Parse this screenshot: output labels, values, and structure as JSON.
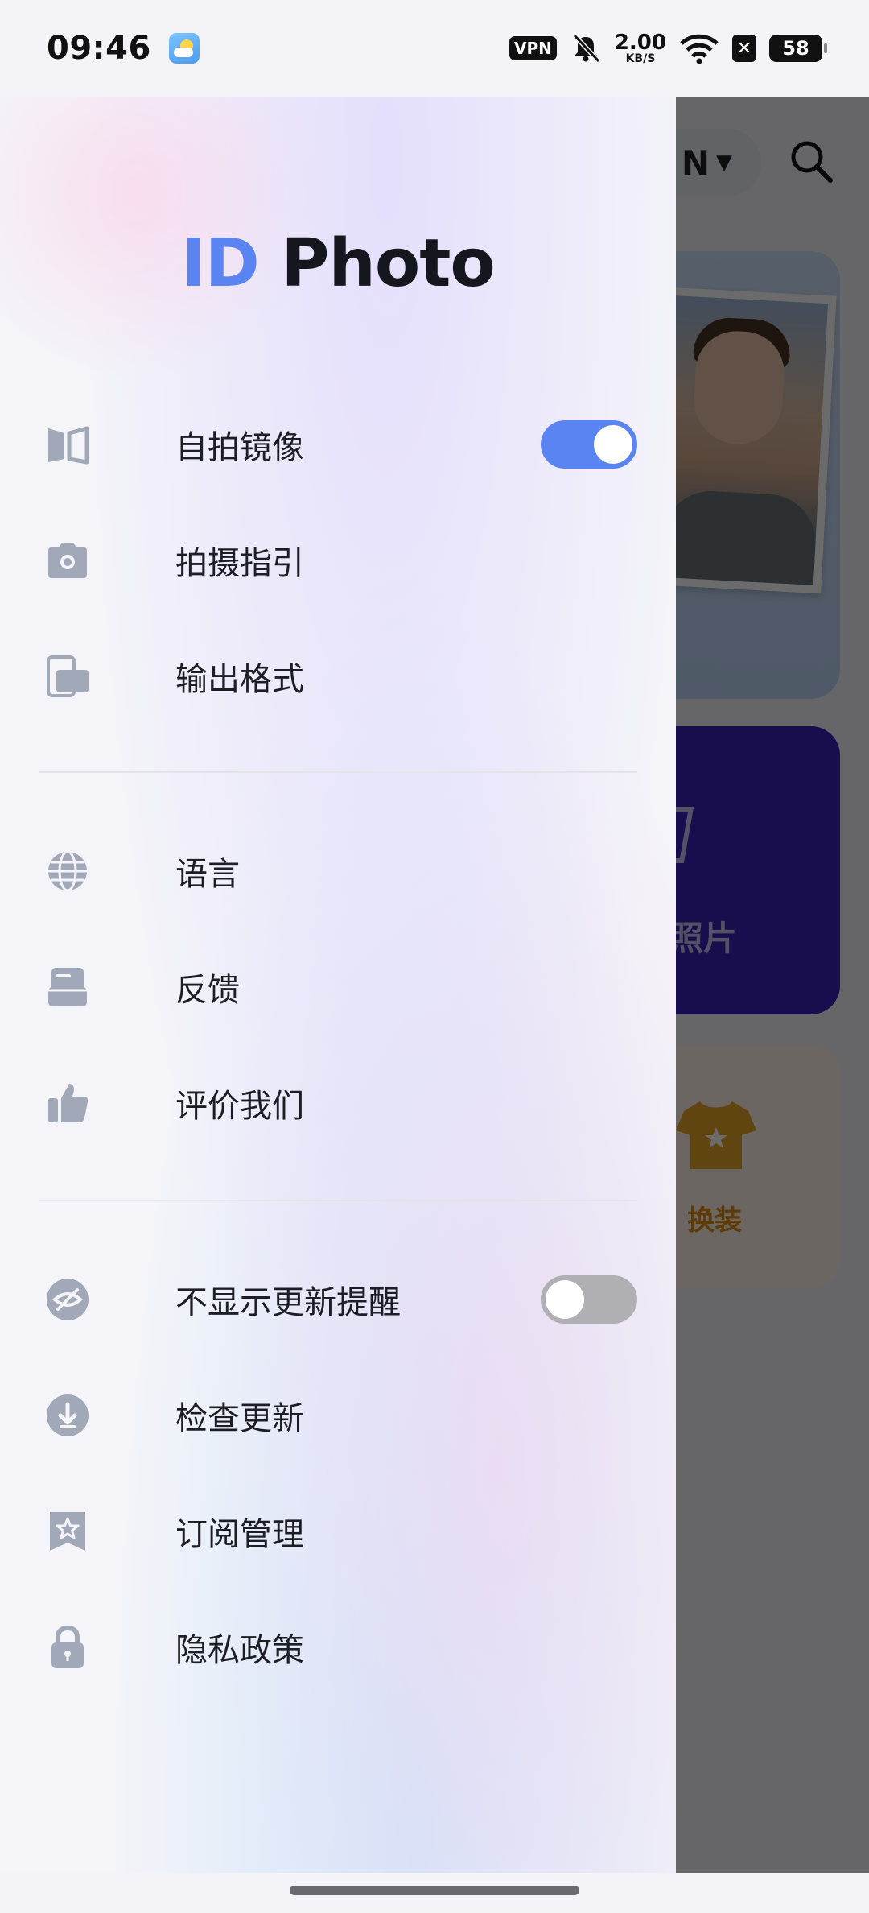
{
  "status_bar": {
    "time": "09:46",
    "weather_icon": "partly-cloudy-icon",
    "vpn": "VPN",
    "net_speed_value": "2.00",
    "net_speed_unit": "KB/S",
    "battery": "58",
    "icons": [
      "mute-bell-icon",
      "wifi-icon",
      "x-app-icon",
      "battery-icon"
    ]
  },
  "background_app": {
    "language_pill": "N",
    "card_purple_label": "照片",
    "card_orange_label": "换装"
  },
  "drawer": {
    "title_part1": "ID",
    "title_part2": "Photo",
    "accent_color": "#5b84f3",
    "icon_color": "#a1a8b8",
    "groups": [
      {
        "items": [
          {
            "label": "自拍镜像",
            "icon": "mirror-icon",
            "toggle": true
          },
          {
            "label": "拍摄指引",
            "icon": "camera-icon"
          },
          {
            "label": "输出格式",
            "icon": "format-icon"
          }
        ]
      },
      {
        "items": [
          {
            "label": "语言",
            "icon": "globe-icon"
          },
          {
            "label": "反馈",
            "icon": "feedback-icon"
          },
          {
            "label": "评价我们",
            "icon": "thumbs-up-icon"
          }
        ]
      },
      {
        "items": [
          {
            "label": "不显示更新提醒",
            "icon": "eye-off-icon",
            "toggle": false
          },
          {
            "label": "检查更新",
            "icon": "download-icon"
          },
          {
            "label": "订阅管理",
            "icon": "star-bookmark-icon"
          },
          {
            "label": "隐私政策",
            "icon": "lock-icon"
          }
        ]
      }
    ]
  }
}
